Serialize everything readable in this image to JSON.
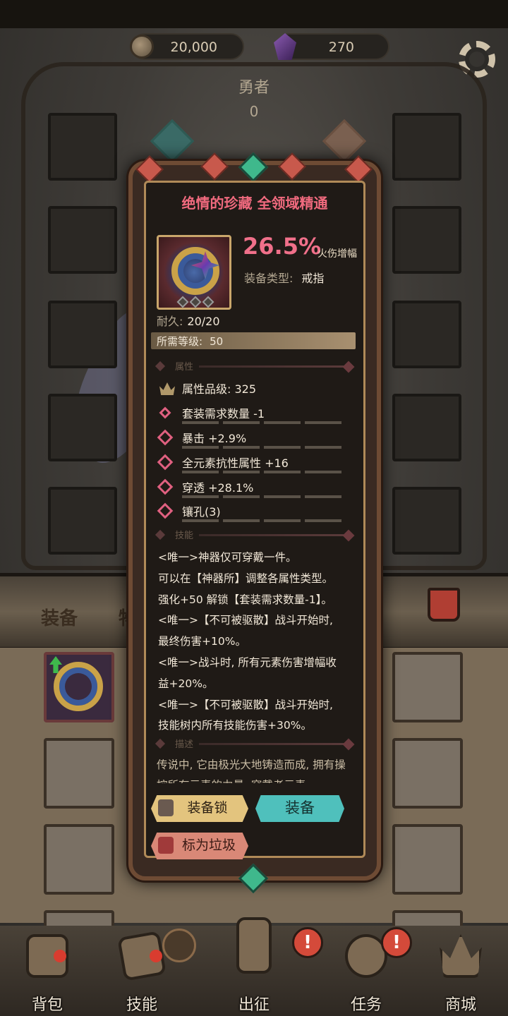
{
  "currency": {
    "coins": "20,000",
    "gems": "270"
  },
  "hero": {
    "name": "勇者",
    "level": "0"
  },
  "tabs": {
    "equip": "装备",
    "items": "物品"
  },
  "popup": {
    "title": "绝情的珍藏 全领域精通",
    "main_value": "26.5%",
    "main_unit": "火伤增幅",
    "equip_type_label": "装备类型:",
    "equip_type_value": "戒指",
    "durability_label": "耐久:",
    "durability_value": "20/20",
    "req_level_label": "所需等级:",
    "req_level_value": "50",
    "section_attributes": "属性",
    "attributes": [
      {
        "text": "属性品级: 325",
        "icon": "crown-icon"
      },
      {
        "text": "套装需求数量 -1",
        "icon": "sparkle-icon"
      },
      {
        "text": "暴击 +2.9%",
        "icon": "diamond-icon"
      },
      {
        "text": "全元素抗性属性 +16",
        "icon": "diamond-icon"
      },
      {
        "text": "穿透 +28.1%",
        "icon": "diamond-icon"
      },
      {
        "text": "镶孔(3)",
        "icon": "diamond-icon"
      }
    ],
    "section_skills": "技能",
    "skills": [
      "<唯一>神器仅可穿戴一件。",
      "可以在【神器所】调整各属性类型。",
      "强化+50 解锁【套装需求数量-1】。",
      "<唯一>【不可被驱散】战斗开始时,",
      "最终伤害+10%。",
      "<唯一>战斗时, 所有元素伤害增幅收",
      "益+20%。",
      "<唯一>【不可被驱散】战斗开始时,",
      "技能树内所有技能伤害+30%。"
    ],
    "section_desc": "描述",
    "description": "传说中, 它由极光大地铸造而成, 拥有操控所有元素的力量, 穿戴者元素",
    "buttons": {
      "lock": "装备锁",
      "equip": "装备",
      "trash": "标为垃圾"
    }
  },
  "nav": [
    {
      "label": "背包",
      "icon": "backpack-icon"
    },
    {
      "label": "技能",
      "icon": "skill-book-icon"
    },
    {
      "label": "出征",
      "icon": "sword-icon"
    },
    {
      "label": "任务",
      "icon": "scroll-icon"
    },
    {
      "label": "商城",
      "icon": "shop-crown-icon"
    }
  ],
  "alerts": [
    "!",
    "!"
  ],
  "colors": {
    "title_pink": "#f06a7e",
    "equip_teal": "#4fc0bc",
    "lock_gold": "#e3c47e",
    "trash_red": "#d98877"
  }
}
